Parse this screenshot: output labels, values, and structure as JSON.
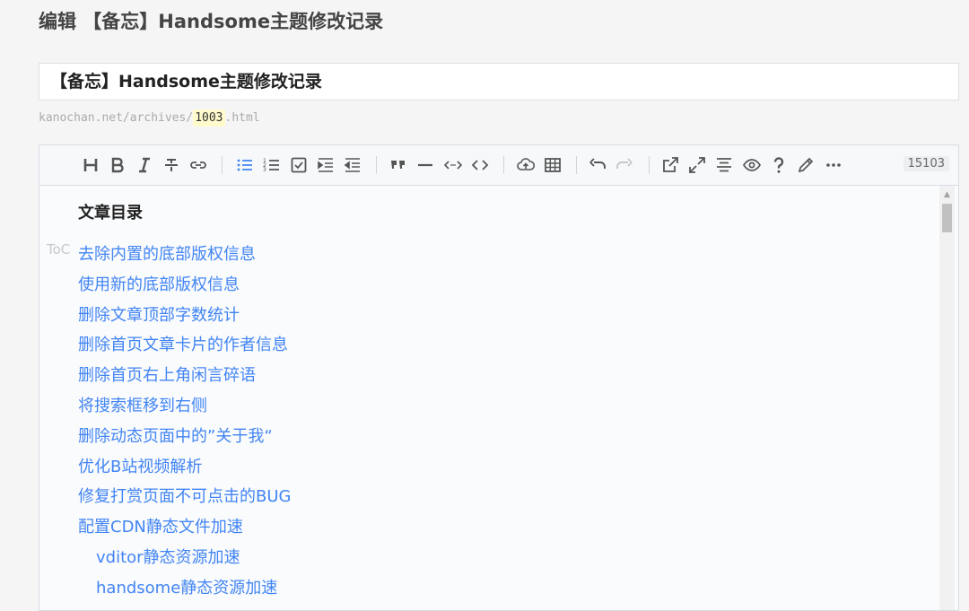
{
  "page": {
    "title": "编辑 【备忘】Handsome主题修改记录"
  },
  "post": {
    "title_value": "【备忘】Handsome主题修改记录",
    "permalink_prefix": "kanochan.net/archives/",
    "permalink_slug": "1003",
    "permalink_suffix": ".html"
  },
  "toolbar": {
    "buttons": [
      {
        "name": "heading-icon",
        "state": "normal"
      },
      {
        "name": "bold-icon",
        "state": "normal"
      },
      {
        "name": "italic-icon",
        "state": "normal"
      },
      {
        "name": "strikethrough-icon",
        "state": "normal"
      },
      {
        "name": "link-icon",
        "state": "normal"
      },
      {
        "name": "bullet-list-icon",
        "state": "active"
      },
      {
        "name": "ordered-list-icon",
        "state": "normal"
      },
      {
        "name": "checklist-icon",
        "state": "normal"
      },
      {
        "name": "indent-icon",
        "state": "normal"
      },
      {
        "name": "outdent-icon",
        "state": "normal"
      },
      {
        "name": "quote-icon",
        "state": "normal"
      },
      {
        "name": "horizontal-rule-icon",
        "state": "normal"
      },
      {
        "name": "inline-code-icon",
        "state": "normal"
      },
      {
        "name": "code-block-icon",
        "state": "normal"
      },
      {
        "name": "upload-icon",
        "state": "normal"
      },
      {
        "name": "table-icon",
        "state": "normal"
      },
      {
        "name": "undo-icon",
        "state": "normal"
      },
      {
        "name": "redo-icon",
        "state": "disabled"
      },
      {
        "name": "edit-mode-icon",
        "state": "normal"
      },
      {
        "name": "fullscreen-icon",
        "state": "normal"
      },
      {
        "name": "outline-icon",
        "state": "normal"
      },
      {
        "name": "preview-icon",
        "state": "normal"
      },
      {
        "name": "help-icon",
        "state": "normal"
      },
      {
        "name": "pencil-icon",
        "state": "normal"
      },
      {
        "name": "more-icon",
        "state": "normal"
      }
    ],
    "char_count": "15103",
    "active_color": "#4285f4",
    "disabled_color": "#c8c8c8"
  },
  "editor": {
    "toc_heading": "文章目录",
    "toc_tag": "ToC",
    "toc_items": [
      {
        "label": "去除内置的底部版权信息",
        "level": 1
      },
      {
        "label": "使用新的底部版权信息",
        "level": 1
      },
      {
        "label": "删除文章顶部字数统计",
        "level": 1
      },
      {
        "label": "删除首页文章卡片的作者信息",
        "level": 1
      },
      {
        "label": "删除首页右上角闲言碎语",
        "level": 1
      },
      {
        "label": "将搜索框移到右侧",
        "level": 1
      },
      {
        "label": "删除动态页面中的”关于我“",
        "level": 1
      },
      {
        "label": "优化B站视频解析",
        "level": 1
      },
      {
        "label": "修复打赏页面不可点击的BUG",
        "level": 1
      },
      {
        "label": "配置CDN静态文件加速",
        "level": 1
      },
      {
        "label": "vditor静态资源加速",
        "level": 2
      },
      {
        "label": "handsome静态资源加速",
        "level": 2
      }
    ],
    "link_color": "#4285f4"
  }
}
